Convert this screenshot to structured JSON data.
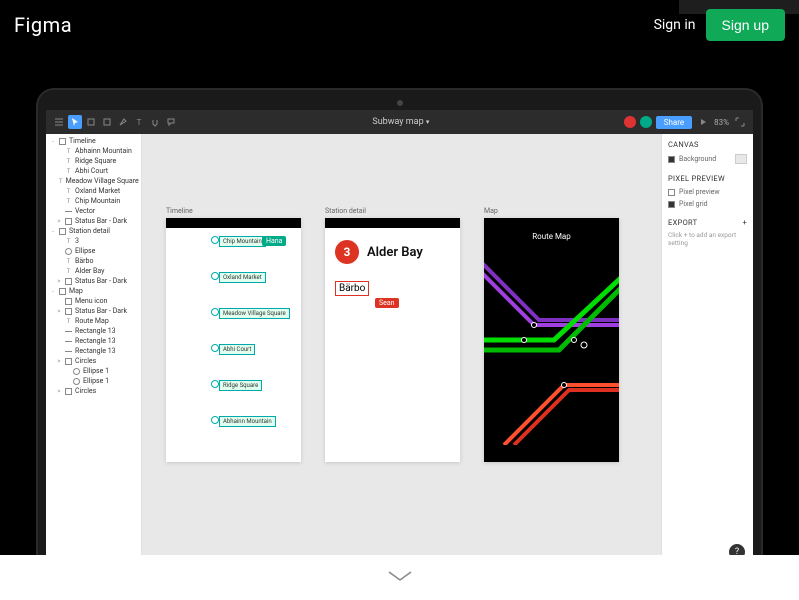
{
  "header": {
    "logo": "Figma",
    "signin": "Sign in",
    "signup": "Sign up"
  },
  "toolbar": {
    "file_name": "Subway map",
    "share": "Share",
    "zoom": "83%",
    "avatars": [
      "#d33",
      "#0a8"
    ]
  },
  "layers": [
    {
      "expand": "-",
      "icon": "frame",
      "label": "Timeline",
      "indent": 0
    },
    {
      "expand": "",
      "icon": "text",
      "label": "Abhainn Mountain",
      "indent": 1
    },
    {
      "expand": "",
      "icon": "text",
      "label": "Ridge Square",
      "indent": 1
    },
    {
      "expand": "",
      "icon": "text",
      "label": "Abhi Court",
      "indent": 1
    },
    {
      "expand": "",
      "icon": "text",
      "label": "Meadow Village Square",
      "indent": 1
    },
    {
      "expand": "",
      "icon": "text",
      "label": "Oxland Market",
      "indent": 1
    },
    {
      "expand": "",
      "icon": "text",
      "label": "Chip Mountain",
      "indent": 1
    },
    {
      "expand": "",
      "icon": "line",
      "label": "Vector",
      "indent": 1
    },
    {
      "expand": ">",
      "icon": "frame",
      "label": "Status Bar - Dark",
      "indent": 1
    },
    {
      "expand": "-",
      "icon": "frame",
      "label": "Station detail",
      "indent": 0
    },
    {
      "expand": "",
      "icon": "text",
      "label": "3",
      "indent": 1
    },
    {
      "expand": "",
      "icon": "ellipse",
      "label": "Ellipse",
      "indent": 1
    },
    {
      "expand": "",
      "icon": "text",
      "label": "Bärbo",
      "indent": 1
    },
    {
      "expand": "",
      "icon": "text",
      "label": "Alder Bay",
      "indent": 1
    },
    {
      "expand": ">",
      "icon": "frame",
      "label": "Status Bar - Dark",
      "indent": 1
    },
    {
      "expand": "-",
      "icon": "frame",
      "label": "Map",
      "indent": 0
    },
    {
      "expand": "",
      "icon": "frame",
      "label": "Menu icon",
      "indent": 1
    },
    {
      "expand": ">",
      "icon": "frame",
      "label": "Status Bar - Dark",
      "indent": 1
    },
    {
      "expand": "",
      "icon": "text",
      "label": "Route Map",
      "indent": 1
    },
    {
      "expand": "",
      "icon": "line",
      "label": "Rectangle 13",
      "indent": 1
    },
    {
      "expand": "",
      "icon": "line",
      "label": "Rectangle 13",
      "indent": 1
    },
    {
      "expand": "",
      "icon": "line",
      "label": "Rectangle 13",
      "indent": 1
    },
    {
      "expand": ">",
      "icon": "frame",
      "label": "Circles",
      "indent": 1
    },
    {
      "expand": "",
      "icon": "ellipse",
      "label": "Ellipse 1",
      "indent": 2
    },
    {
      "expand": "",
      "icon": "ellipse",
      "label": "Ellipse 1",
      "indent": 2
    },
    {
      "expand": ">",
      "icon": "frame",
      "label": "Circles",
      "indent": 1
    }
  ],
  "canvas": {
    "artboard1": {
      "label": "Timeline",
      "user_tag": "Hana",
      "stations": [
        "Chip Mountain",
        "Oxland Market",
        "Meadow Village Square",
        "Abhi Court",
        "Ridge Square",
        "Abhainn Mountain"
      ]
    },
    "artboard2": {
      "label": "Station detail",
      "line_number": "3",
      "station": "Alder Bay",
      "sub_station": "Bärbo",
      "user_tag": "Sean"
    },
    "artboard3": {
      "label": "Map",
      "title": "Route Map"
    }
  },
  "props": {
    "canvas_title": "CANVAS",
    "background": "Background",
    "pixel_preview_title": "PIXEL PREVIEW",
    "pixel_preview": "Pixel preview",
    "pixel_grid": "Pixel grid",
    "export_title": "EXPORT",
    "hint": "Click + to add an export setting"
  },
  "help": "?"
}
